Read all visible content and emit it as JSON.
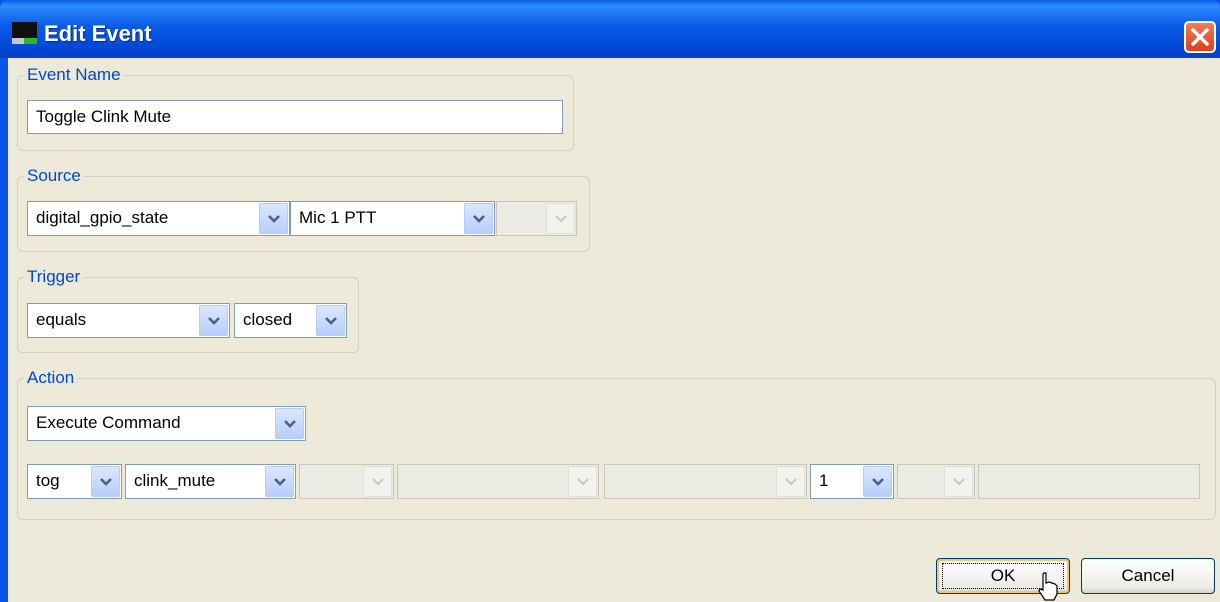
{
  "window": {
    "title": "Edit Event"
  },
  "event_name": {
    "legend": "Event Name",
    "value": "Toggle Clink Mute"
  },
  "source": {
    "legend": "Source",
    "field1": "digital_gpio_state",
    "field2": "Mic 1 PTT",
    "field3": ""
  },
  "trigger": {
    "legend": "Trigger",
    "operator": "equals",
    "state": "closed"
  },
  "action": {
    "legend": "Action",
    "type": "Execute Command",
    "params": [
      "tog",
      "clink_mute",
      "",
      "",
      "",
      "1",
      "",
      ""
    ]
  },
  "buttons": {
    "ok": "OK",
    "cancel": "Cancel"
  },
  "colors": {
    "titlebar": "#0a55e4",
    "legend": "#0046d5",
    "dialog_bg": "#ece9d8"
  },
  "icons": [
    "app-icon",
    "close-icon",
    "chevron-down-icon",
    "mouse-cursor-icon"
  ]
}
